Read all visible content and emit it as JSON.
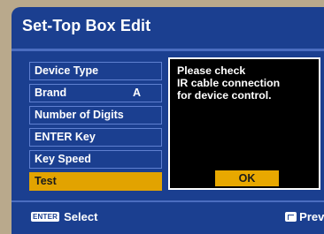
{
  "header": {
    "title": "Set-Top Box Edit"
  },
  "menu": {
    "items": [
      {
        "label": "Device Type",
        "value": ""
      },
      {
        "label": "Brand",
        "value": "A"
      },
      {
        "label": "Number of Digits",
        "value": ""
      },
      {
        "label": "ENTER Key",
        "value": ""
      },
      {
        "label": "Key Speed",
        "value": ""
      },
      {
        "label": "Test",
        "value": ""
      }
    ],
    "selected": "Test"
  },
  "dialog": {
    "lines": [
      "Please check",
      "IR cable connection",
      "for device control."
    ],
    "ok_label": "OK"
  },
  "footer": {
    "enter_key_label": "ENTER",
    "select_label": "Select",
    "prev_label": "Prev.",
    "prev_icon": "back-icon"
  },
  "colors": {
    "background_panel": "#1b3f90",
    "highlight": "#e2a300",
    "dialog_bg": "#000000"
  }
}
